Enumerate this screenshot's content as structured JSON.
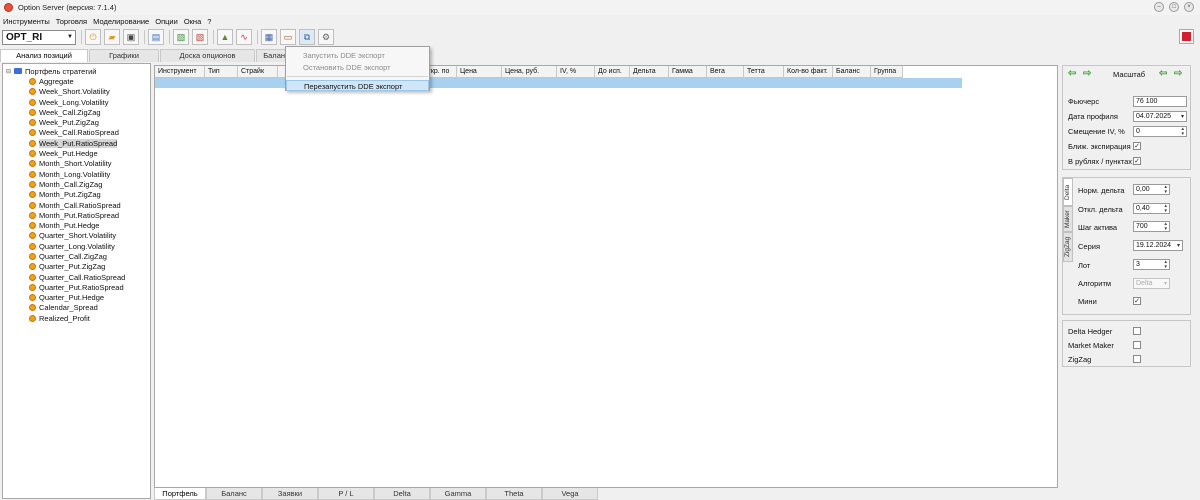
{
  "window": {
    "title": "Option Server (версия: 7.1.4)"
  },
  "menu": [
    "Инструменты",
    "Торговля",
    "Моделирование",
    "Опции",
    "Окна",
    "?"
  ],
  "toolbar": {
    "instrument": "OPT_RI"
  },
  "top_tabs": [
    "Анализ позиций",
    "Графики",
    "Доска опционов",
    "Баланс"
  ],
  "tree": {
    "root": "Портфель стратегий",
    "items": [
      "Aggregate",
      "Week_Short.Volatility",
      "Week_Long.Volatility",
      "Week_Call.ZigZag",
      "Week_Put.ZigZag",
      "Week_Call.RatioSpread",
      "Week_Put.RatioSpread",
      "Week_Put.Hedge",
      "Month_Short.Volatility",
      "Month_Long.Volatility",
      "Month_Call.ZigZag",
      "Month_Put.ZigZag",
      "Month_Call.RatioSpread",
      "Month_Put.RatioSpread",
      "Month_Put.Hedge",
      "Quarter_Short.Volatility",
      "Quarter_Long.Volatility",
      "Quarter_Call.ZigZag",
      "Quarter_Put.ZigZag",
      "Quarter_Call.RatioSpread",
      "Quarter_Put.RatioSpread",
      "Quarter_Put.Hedge",
      "Calendar_Spread",
      "Realized_Profit"
    ],
    "selected": "Week_Put.RatioSpread"
  },
  "grid": {
    "columns": [
      "Инструмент",
      "Тип",
      "Страйк",
      "",
      "",
      "-во",
      "Поза откр. по",
      "Цена",
      "Цена, руб.",
      "IV, %",
      "До исп.",
      "Дельта",
      "Гамма",
      "Вега",
      "Тетта",
      "Кол-во факт.",
      "Баланс",
      "Группа"
    ]
  },
  "dde_menu": {
    "start": "Запустить DDE экспорт",
    "stop": "Остановить DDE экспорт",
    "restart": "Перезапустить DDE экспорт"
  },
  "bottom_tabs": [
    "Портфель",
    "Баланс",
    "Заявки",
    "P / L",
    "Delta",
    "Gamma",
    "Theta",
    "Vega"
  ],
  "scale_panel": {
    "label": "Масштаб",
    "futures_label": "Фьючерс",
    "futures_value": "76 100",
    "profile_date_label": "Дата профиля",
    "profile_date_value": "04.07.2025",
    "iv_shift_label": "Смещение IV, %",
    "iv_shift_value": "0",
    "near_expiry_label": "Ближ. экспирация",
    "near_expiry_checked": true,
    "rub_label": "В рублях / пунктах",
    "rub_checked": true
  },
  "algo_panel": {
    "vtabs": [
      "Delta",
      "Maker",
      "ZigZag"
    ],
    "norm_delta_label": "Норм. дельта",
    "norm_delta_value": "0,00",
    "dev_delta_label": "Откл. дельта",
    "dev_delta_value": "0,40",
    "asset_step_label": "Шаг актива",
    "asset_step_value": "700",
    "series_label": "Серия",
    "series_value": "19.12.2024",
    "lot_label": "Лот",
    "lot_value": "3",
    "algo_label": "Алгоритм",
    "algo_value": "Delta",
    "mini_label": "Мини",
    "mini_checked": true
  },
  "hedge_panel": {
    "items": [
      "Delta Hedger",
      "Market Maker",
      "ZigZag"
    ]
  }
}
